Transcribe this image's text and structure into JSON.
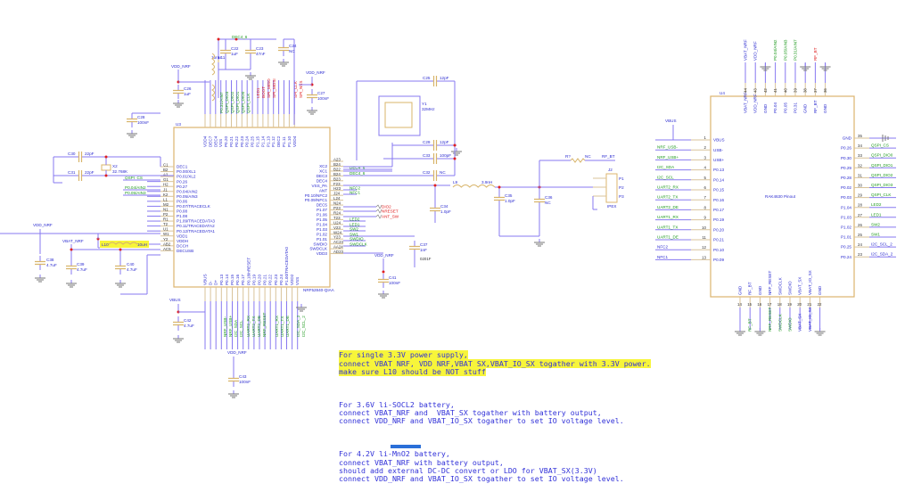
{
  "colors": {
    "wire": "#8778f0",
    "pin": "#d8c39a",
    "part_outline": "#dcb46e",
    "net_label": "#1f9a1f",
    "signal_red": "#e02020",
    "text": "#2b2bd0",
    "highlight": "#f7f53a"
  },
  "u3": {
    "ref": "U3",
    "part": "NRF52840-QIAA",
    "left_pins": [
      [
        "C1",
        "DEC1"
      ],
      [
        "B2",
        "P0.00/XL1"
      ],
      [
        "A2",
        "P0.01/XL2"
      ],
      [
        "G1",
        "P0.26"
      ],
      [
        "H2",
        "P0.27"
      ],
      [
        "J1",
        "P0.04/AIN2"
      ],
      [
        "K2",
        "P0.05/AIN3"
      ],
      [
        "L1",
        "P0.06"
      ],
      [
        "M2",
        "P0.07/TRACECLK"
      ],
      [
        "N1",
        "P0.08"
      ],
      [
        "P2",
        "P1.08"
      ],
      [
        "R1",
        "P1.09/TRACEDATA3"
      ],
      [
        "T2",
        "P0.11/TRACEDATA2"
      ],
      [
        "U1",
        "P0.12/TRACEDATA1"
      ],
      [
        "W1",
        "VDD1"
      ],
      [
        "Y2",
        "VDDH"
      ],
      [
        "AB2",
        "DCCH"
      ],
      [
        "AC5",
        "DECUSB"
      ]
    ],
    "right_pins": [
      [
        "A23",
        ""
      ],
      [
        "B24",
        "XC2"
      ],
      [
        "B22",
        "XC1"
      ],
      [
        "B24",
        "DEC3"
      ],
      [
        "B23",
        "DEC4"
      ],
      [
        "F23",
        "VSS_PA"
      ],
      [
        "H23",
        "ANT"
      ],
      [
        "J24",
        "P0.10/NFC2"
      ],
      [
        "L24",
        "P0.09/NFC1"
      ],
      [
        "N24",
        "DEC5"
      ],
      [
        "P23",
        "P1.07"
      ],
      [
        "R24",
        "P1.06"
      ],
      [
        "T23",
        "P1.05"
      ],
      [
        "U24",
        "P1.04"
      ],
      [
        "V23",
        "P1.03"
      ],
      [
        "W24",
        "P1.02"
      ],
      [
        "Y23",
        "P1.01"
      ],
      [
        "AC24",
        "SWDIO"
      ],
      [
        "AA24",
        "SWDCLK"
      ],
      [
        "AD23",
        "VDD3"
      ]
    ],
    "top_pins": [
      "VDD4",
      "DEC7",
      "DEC4",
      "VSS",
      "P0.20",
      "P0.21",
      "P0.22",
      "P0.23",
      "P0.24",
      "P0.25",
      "P1.15",
      "P1.14",
      "P1.13",
      "P1.12",
      "DEC2",
      "P1.11",
      "P1.10",
      "VDD4"
    ],
    "bottom_pins": [
      "VBUS",
      "D-",
      "D+",
      "P0.13",
      "P0.14",
      "P0.15",
      "P0.16",
      "P0.17",
      "P0.18/nRESET",
      "P0.19",
      "P0.20",
      "P0.21",
      "P0.22",
      "P0.23",
      "P0.24",
      "P1.00/TRACEDATA0",
      "VDD2",
      "VSS"
    ]
  },
  "u4": {
    "ref": "U4",
    "title": "RAK4630 Pinout",
    "left_pins": [
      [
        "1",
        "VBUS",
        "VBUS"
      ],
      [
        "2",
        "USB-",
        "NRF_USB-"
      ],
      [
        "3",
        "USB+",
        "NRF_USB+"
      ],
      [
        "4",
        "P0.13",
        "I2C_SDA"
      ],
      [
        "5",
        "P0.14",
        "I2C_SCL"
      ],
      [
        "6",
        "P0.15",
        "UART2_RX"
      ],
      [
        "7",
        "P0.16",
        "UART2_TX"
      ],
      [
        "8",
        "P0.17",
        "UART2_DE"
      ],
      [
        "9",
        "P0.19",
        "UART1_RX"
      ],
      [
        "10",
        "P0.20",
        "UART1_TX"
      ],
      [
        "11",
        "P0.21",
        "UART1_DE"
      ],
      [
        "12",
        "P0.10",
        "NFC2"
      ],
      [
        "13",
        "P0.09",
        "NFC1"
      ]
    ],
    "right_pins": [
      [
        "35",
        "GND",
        ""
      ],
      [
        "34",
        "P0.26",
        "QSPI_CS"
      ],
      [
        "33",
        "P0.30",
        "QSPI_DIO0"
      ],
      [
        "32",
        "P0.29",
        "QSPI_DIO1"
      ],
      [
        "31",
        "P0.28",
        "QSPI_DIO2"
      ],
      [
        "30",
        "P0.02",
        "QSPI_DIO3"
      ],
      [
        "29",
        "P0.03",
        "QSPI_CLK"
      ],
      [
        "28",
        "P1.04",
        "LED2"
      ],
      [
        "27",
        "P1.03",
        "LED1"
      ],
      [
        "26",
        "P1.02",
        "SW2"
      ],
      [
        "25",
        "P1.01",
        "SW1"
      ],
      [
        "24",
        "P0.25",
        "I2C_SCL_2"
      ],
      [
        "23",
        "P0.24",
        "I2C_SDA_2"
      ]
    ],
    "top_pins": [
      [
        "44",
        "VBAT_NRF",
        "VBAT_NRF"
      ],
      [
        "43",
        "VDD_NRF",
        "VDD_NRF"
      ],
      [
        "42",
        "GND",
        ""
      ],
      [
        "41",
        "P0.04",
        "P0.04/AIN2"
      ],
      [
        "40",
        "P0.05",
        "P0.05/AIN3"
      ],
      [
        "39",
        "P0.31",
        "P0.31/AIN7"
      ],
      [
        "38",
        "GND",
        ""
      ],
      [
        "37",
        "RF_BT",
        "RF_BT"
      ],
      [
        "36",
        "GND",
        ""
      ]
    ],
    "bottom_pins": [
      [
        "14",
        "GND",
        ""
      ],
      [
        "15",
        "RF_BT",
        "RF_BT"
      ],
      [
        "16",
        "GND",
        ""
      ],
      [
        "17",
        "NRF_RESET",
        "NRF_RESET"
      ],
      [
        "18",
        "SWDCLK",
        "SWDCLK"
      ],
      [
        "19",
        "SWDIO",
        "SWDIO"
      ],
      [
        "20",
        "VBAT_SX",
        "VBAT_SX"
      ],
      [
        "21",
        "VBAT_IO_SX",
        "VBAT_IO_SX"
      ],
      [
        "22",
        "GND",
        ""
      ]
    ]
  },
  "components": [
    {
      "ref": "C22",
      "value": "1uF"
    },
    {
      "ref": "C23",
      "value": "47nF"
    },
    {
      "ref": "C24",
      "value": "NC"
    },
    {
      "ref": "C26",
      "value": "1uF"
    },
    {
      "ref": "C27",
      "value": "100nF"
    },
    {
      "ref": "C28",
      "value": "100nF"
    },
    {
      "ref": "C25",
      "value": "12pF"
    },
    {
      "ref": "C29",
      "value": "12pF"
    },
    {
      "ref": "C33",
      "value": "100pF"
    },
    {
      "ref": "C32",
      "value": "NC"
    },
    {
      "ref": "C30",
      "value": "22pF"
    },
    {
      "ref": "C31",
      "value": "22pF"
    },
    {
      "ref": "X2",
      "value": "32.768K"
    },
    {
      "ref": "Y1",
      "value": "32MHz"
    },
    {
      "ref": "L9",
      "value": "3.9nH"
    },
    {
      "ref": "C34",
      "value": "1.0pF"
    },
    {
      "ref": "C35",
      "value": "1.0pF"
    },
    {
      "ref": "C36",
      "value": "NC"
    },
    {
      "ref": "R?",
      "value": "NC"
    },
    {
      "ref": "J2",
      "value": "IPEX"
    },
    {
      "ref": "C37",
      "value": "1nF"
    },
    {
      "ref": "C41",
      "value": "100nF"
    },
    {
      "ref": "C38",
      "value": "4.7uF"
    },
    {
      "ref": "C39",
      "value": "4.7uF"
    },
    {
      "ref": "C40",
      "value": "4.7uF"
    },
    {
      "ref": "C42",
      "value": "4.7uF"
    },
    {
      "ref": "C43",
      "value": "100nF"
    },
    {
      "ref": "L10",
      "value": "10uH"
    },
    {
      "ref": "L1",
      "value": "10uH"
    },
    {
      "ref": "L11",
      "value": "15nH"
    }
  ],
  "nets": {
    "vdd_nrf": "VDD_NRF",
    "vbat_nrf": "VBAT_NRF",
    "vbus": "VBUS",
    "dec4_6": "DEC4_6",
    "rf_bt": "RF_BT",
    "c37_note": "0201F",
    "u3_left": [
      "QSPI_CS",
      "P0.04/AIN2",
      "P0.05/AIN3"
    ],
    "u3_right_green": [
      "DEC4_6",
      "NFC2",
      "NFC1",
      "LED2",
      "LED1",
      "SW2",
      "SW1",
      "SWDIO",
      "SWDCLK"
    ],
    "u3_right_red": [
      "DIO2",
      "NRESET",
      "ANT_SW"
    ],
    "u3_top_green": [
      "P0.31/AIN7",
      "QSPI_DIO3",
      "QSPI_DIO2",
      "QSPI_DIO1",
      "QSPI_DIO0",
      "QSPI_CLK"
    ],
    "u3_top_red": [
      "LED1",
      "BOOT",
      "SPI_MISO",
      "SPI_MOSI",
      "SPI_CLK",
      "SPI_NSS"
    ],
    "u3_bottom_green": [
      "NRF_USB-",
      "NRF_USB+",
      "I2C_SDA",
      "I2C_SCL",
      "UART2_RX",
      "UART2_TX",
      "UART2_DE",
      "NRF_RESET",
      "UART1_RX",
      "UART1_TX",
      "UART1_DE",
      "I2C_SDA_2",
      "I2C_SCL_2"
    ]
  },
  "notes": [
    {
      "highlight": true,
      "lines": [
        "For single 3.3V power supply,",
        "connect VBAT_NRF, VDD_NRF,VBAT_SX,VBAT_IO_SX togather with 3.3V power.",
        "make sure L10 should be NOT stuff"
      ]
    },
    {
      "highlight": false,
      "lines": [
        "For 3.6V li-SOCL2 battery,",
        "connect VBAT_NRF and  VBAT_SX togather with battery output,",
        "connect VDD_NRF and VBAT_IO_SX togather to set IO voltage level."
      ]
    },
    {
      "highlight": false,
      "lines": [
        "For 4.2V li-MnO2 battery,",
        "connect VBAT_NRF with battery output,",
        "should add external DC-DC convert or LDO for VBAT_SX(3.3V)",
        "connect VDD_NRF and VBAT_IO_SX togather to set IO voltage level."
      ]
    }
  ]
}
